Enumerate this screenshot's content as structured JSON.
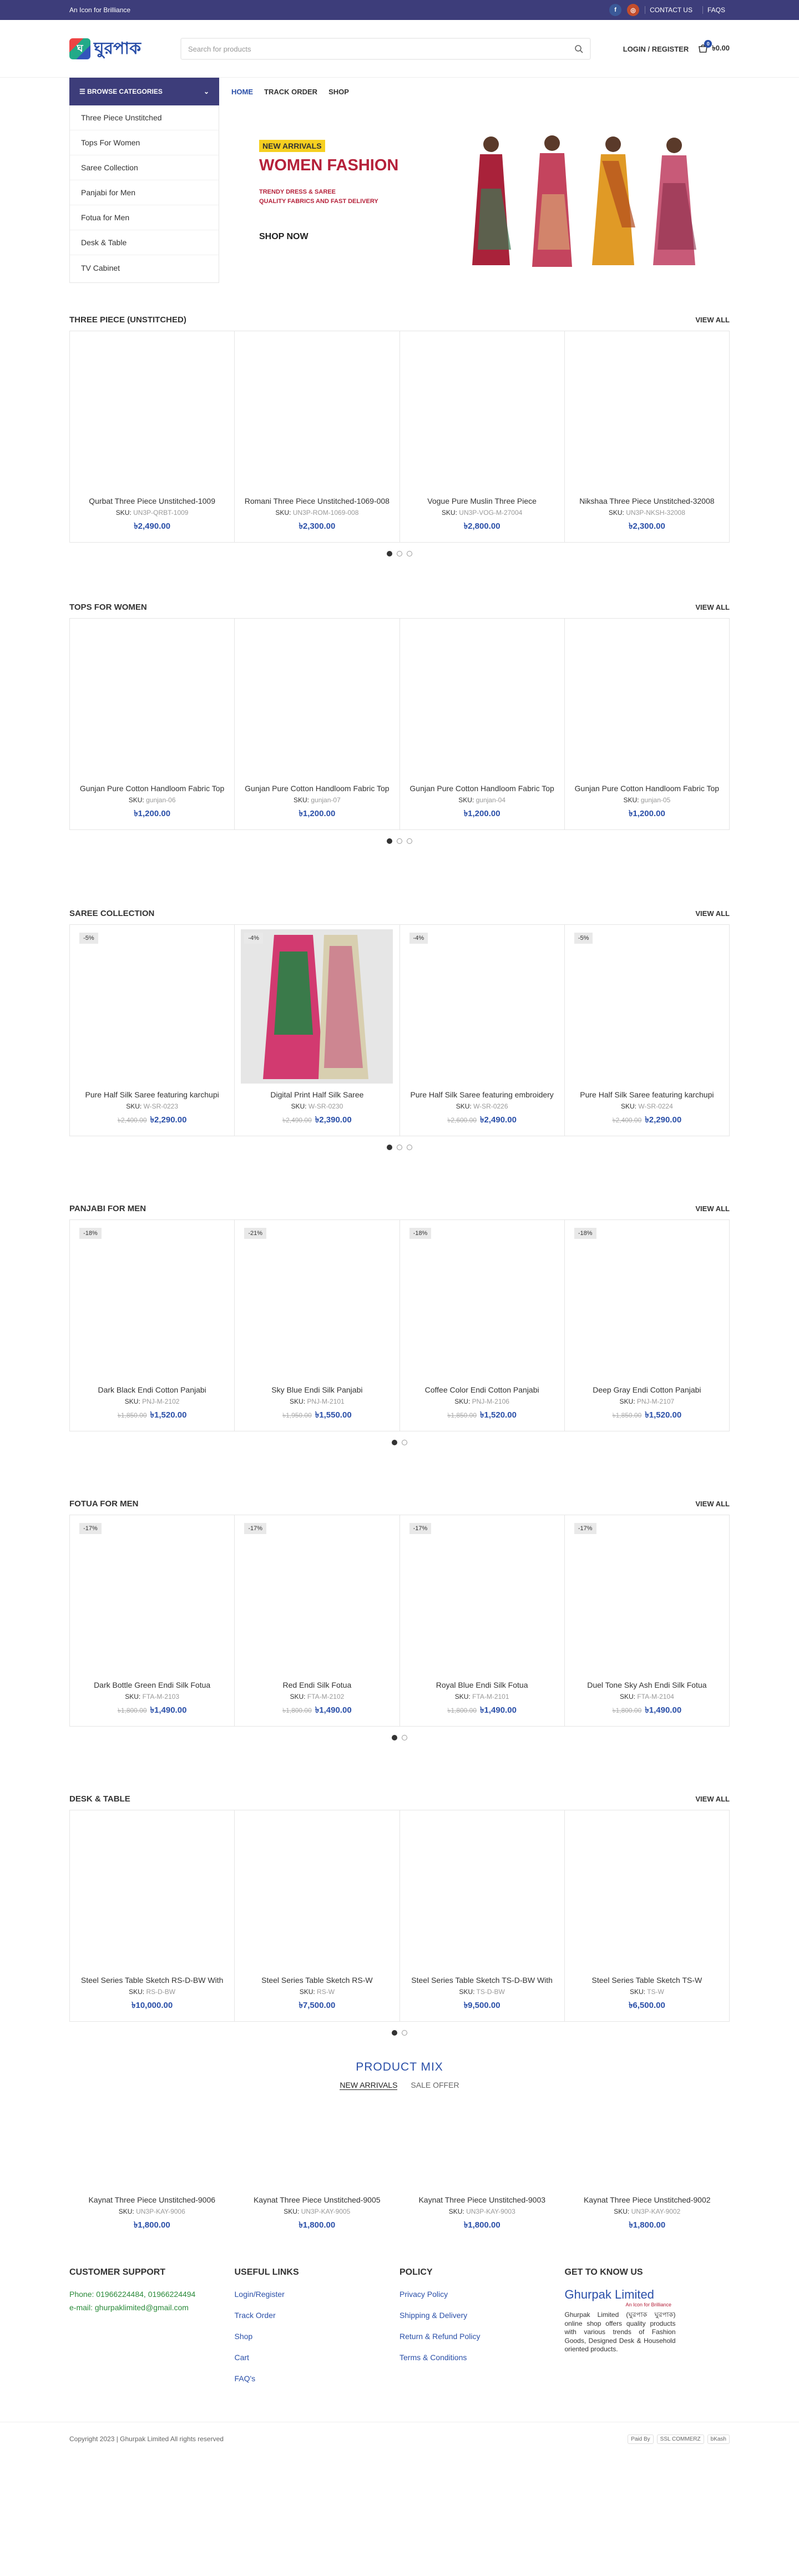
{
  "topbar": {
    "tagline": "An Icon for Brilliance",
    "fb": "f",
    "ig": "◎",
    "contact": "CONTACT US",
    "faqs": "FAQS"
  },
  "header": {
    "logo_text": "ঘুরপাক",
    "search_placeholder": "Search for products",
    "login": "LOGIN / REGISTER",
    "cart_count": "0",
    "cart_total": "৳0.00"
  },
  "nav": {
    "browse": "Browse Categories",
    "items": [
      "HOME",
      "TRACK ORDER",
      "SHOP"
    ]
  },
  "categories": [
    "Three Piece Unstitched",
    "Tops For Women",
    "Saree Collection",
    "Panjabi for Men",
    "Fotua for Men",
    "Desk & Table",
    "TV Cabinet"
  ],
  "banner": {
    "new_arrivals": "NEW ARRIVALS",
    "title": "WOMEN FASHION",
    "line1": "TRENDY DRESS & SAREE",
    "line2": "QUALITY FABRICS AND FAST DELIVERY",
    "cta": "SHOP NOW"
  },
  "sections": [
    {
      "title": "Three Piece (Unstitched)",
      "view_all": "VIEW ALL",
      "dots": 3,
      "products": [
        {
          "name": "Qurbat Three Piece Unstitched-1009",
          "sku_label": "SKU:",
          "sku": "UN3P-QRBT-1009",
          "price": "৳2,490.00",
          "old": "",
          "badge": ""
        },
        {
          "name": "Romani Three Piece Unstitched-1069-008",
          "sku_label": "SKU:",
          "sku": "UN3P-ROM-1069-008",
          "price": "৳2,300.00",
          "old": "",
          "badge": ""
        },
        {
          "name": "Vogue Pure Muslin Three Piece",
          "sku_label": "SKU:",
          "sku": "UN3P-VOG-M-27004",
          "price": "৳2,800.00",
          "old": "",
          "badge": ""
        },
        {
          "name": "Nikshaa Three Piece Unstitched-32008",
          "sku_label": "SKU:",
          "sku": "UN3P-NKSH-32008",
          "price": "৳2,300.00",
          "old": "",
          "badge": ""
        }
      ]
    },
    {
      "title": "Tops For Women",
      "view_all": "VIEW ALL",
      "dots": 3,
      "products": [
        {
          "name": "Gunjan Pure Cotton Handloom Fabric Top",
          "sku_label": "SKU:",
          "sku": "gunjan-06",
          "price": "৳1,200.00",
          "old": "",
          "badge": ""
        },
        {
          "name": "Gunjan Pure Cotton Handloom Fabric Top",
          "sku_label": "SKU:",
          "sku": "gunjan-07",
          "price": "৳1,200.00",
          "old": "",
          "badge": ""
        },
        {
          "name": "Gunjan Pure Cotton Handloom Fabric Top",
          "sku_label": "SKU:",
          "sku": "gunjan-04",
          "price": "৳1,200.00",
          "old": "",
          "badge": ""
        },
        {
          "name": "Gunjan Pure Cotton Handloom Fabric Top",
          "sku_label": "SKU:",
          "sku": "gunjan-05",
          "price": "৳1,200.00",
          "old": "",
          "badge": ""
        }
      ]
    },
    {
      "title": "Saree Collection",
      "view_all": "VIEW ALL",
      "dots": 3,
      "products": [
        {
          "name": "Pure Half Silk Saree featuring karchupi",
          "sku_label": "SKU:",
          "sku": "W-SR-0223",
          "price": "৳2,290.00",
          "old": "৳2,400.00",
          "badge": "-5%"
        },
        {
          "name": "Digital Print Half Silk Saree",
          "sku_label": "SKU:",
          "sku": "W-SR-0230",
          "price": "৳2,390.00",
          "old": "৳2,490.00",
          "badge": "-4%"
        },
        {
          "name": "Pure Half Silk Saree featuring embroidery",
          "sku_label": "SKU:",
          "sku": "W-SR-0226",
          "price": "৳2,490.00",
          "old": "৳2,600.00",
          "badge": "-4%"
        },
        {
          "name": "Pure Half Silk Saree featuring karchupi",
          "sku_label": "SKU:",
          "sku": "W-SR-0224",
          "price": "৳2,290.00",
          "old": "৳2,400.00",
          "badge": "-5%"
        }
      ]
    },
    {
      "title": "Panjabi For Men",
      "view_all": "VIEW ALL",
      "dots": 2,
      "products": [
        {
          "name": "Dark Black Endi Cotton Panjabi",
          "sku_label": "SKU:",
          "sku": "PNJ-M-2102",
          "price": "৳1,520.00",
          "old": "৳1,850.00",
          "badge": "-18%"
        },
        {
          "name": "Sky Blue Endi Silk Panjabi",
          "sku_label": "SKU:",
          "sku": "PNJ-M-2101",
          "price": "৳1,550.00",
          "old": "৳1,950.00",
          "badge": "-21%"
        },
        {
          "name": "Coffee Color Endi Cotton Panjabi",
          "sku_label": "SKU:",
          "sku": "PNJ-M-2106",
          "price": "৳1,520.00",
          "old": "৳1,850.00",
          "badge": "-18%"
        },
        {
          "name": "Deep Gray Endi Cotton Panjabi",
          "sku_label": "SKU:",
          "sku": "PNJ-M-2107",
          "price": "৳1,520.00",
          "old": "৳1,850.00",
          "badge": "-18%"
        }
      ]
    },
    {
      "title": "Fotua For Men",
      "view_all": "VIEW ALL",
      "dots": 2,
      "products": [
        {
          "name": "Dark Bottle Green Endi Silk Fotua",
          "sku_label": "SKU:",
          "sku": "FTA-M-2103",
          "price": "৳1,490.00",
          "old": "৳1,800.00",
          "badge": "-17%"
        },
        {
          "name": "Red Endi Silk Fotua",
          "sku_label": "SKU:",
          "sku": "FTA-M-2102",
          "price": "৳1,490.00",
          "old": "৳1,800.00",
          "badge": "-17%"
        },
        {
          "name": "Royal Blue Endi Silk Fotua",
          "sku_label": "SKU:",
          "sku": "FTA-M-2101",
          "price": "৳1,490.00",
          "old": "৳1,800.00",
          "badge": "-17%"
        },
        {
          "name": "Duel Tone Sky Ash Endi Silk Fotua",
          "sku_label": "SKU:",
          "sku": "FTA-M-2104",
          "price": "৳1,490.00",
          "old": "৳1,800.00",
          "badge": "-17%"
        }
      ]
    },
    {
      "title": "Desk & Table",
      "view_all": "VIEW ALL",
      "dots": 2,
      "products": [
        {
          "name": "Steel Series Table Sketch RS-D-BW With",
          "sku_label": "SKU:",
          "sku": "RS-D-BW",
          "price": "৳10,000.00",
          "old": "",
          "badge": ""
        },
        {
          "name": "Steel Series Table Sketch RS-W",
          "sku_label": "SKU:",
          "sku": "RS-W",
          "price": "৳7,500.00",
          "old": "",
          "badge": ""
        },
        {
          "name": "Steel Series Table Sketch TS-D-BW With",
          "sku_label": "SKU:",
          "sku": "TS-D-BW",
          "price": "৳9,500.00",
          "old": "",
          "badge": ""
        },
        {
          "name": "Steel Series Table Sketch TS-W",
          "sku_label": "SKU:",
          "sku": "TS-W",
          "price": "৳6,500.00",
          "old": "",
          "badge": ""
        }
      ]
    }
  ],
  "mix": {
    "title": "PRODUCT MIX",
    "tabs": [
      "NEW ARRIVALS",
      "SALE OFFER"
    ],
    "products": [
      {
        "name": "Kaynat Three Piece Unstitched-9006",
        "sku_label": "SKU:",
        "sku": "UN3P-KAY-9006",
        "price": "৳1,800.00",
        "old": "",
        "badge": ""
      },
      {
        "name": "Kaynat Three Piece Unstitched-9005",
        "sku_label": "SKU:",
        "sku": "UN3P-KAY-9005",
        "price": "৳1,800.00",
        "old": "",
        "badge": ""
      },
      {
        "name": "Kaynat Three Piece Unstitched-9003",
        "sku_label": "SKU:",
        "sku": "UN3P-KAY-9003",
        "price": "৳1,800.00",
        "old": "",
        "badge": ""
      },
      {
        "name": "Kaynat Three Piece Unstitched-9002",
        "sku_label": "SKU:",
        "sku": "UN3P-KAY-9002",
        "price": "৳1,800.00",
        "old": "",
        "badge": ""
      }
    ]
  },
  "footer": {
    "support": {
      "title": "CUSTOMER SUPPORT",
      "phone": "Phone: 01966224484, 01966224494",
      "email": "e-mail: ghurpaklimited@gmail.com"
    },
    "links": {
      "title": "USEFUL LINKS",
      "items": [
        "Login/Register",
        "Track Order",
        "Shop",
        "Cart",
        "FAQ's"
      ]
    },
    "policy": {
      "title": "POLICY",
      "items": [
        "Privacy Policy",
        "Shipping & Delivery",
        "Return & Refund Policy",
        "Terms & Conditions"
      ]
    },
    "about": {
      "title": "GET TO KNOW US",
      "brand": "Ghurpak Limited",
      "brand_sub": "An Icon for Brilliance",
      "text": "Ghurpak Limited (ঘুরপাক ঘুরপাক) online shop offers quality products with various trends of Fashion Goods, Designed Desk & Household oriented products."
    },
    "copyright": "Copyright 2023 | Ghurpak Limited All rights reserved",
    "payments": [
      "Paid By",
      "SSL COMMERZ",
      "bKash"
    ]
  },
  "colors": {
    "brand": "#3d3d7a",
    "accent": "#2a4fa8",
    "sale": "#b5213a"
  }
}
